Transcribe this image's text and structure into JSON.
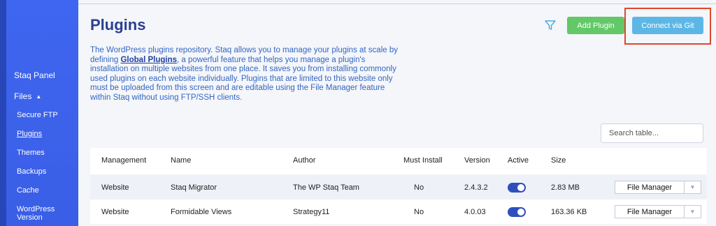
{
  "sidebar": {
    "items": [
      {
        "label": "Staq Panel"
      },
      {
        "label": "Files"
      },
      {
        "label": "Secure FTP"
      },
      {
        "label": "Plugins"
      },
      {
        "label": "Themes"
      },
      {
        "label": "Backups"
      },
      {
        "label": "Cache"
      },
      {
        "label": "WordPress"
      },
      {
        "label": "Version"
      }
    ],
    "files_caret": "▲"
  },
  "header": {
    "title": "Plugins",
    "add_label": "Add Plugin",
    "git_label": "Connect via Git"
  },
  "description": {
    "part1": "The WordPress plugins repository. Staq allows you to manage your plugins at scale by defining ",
    "link": "Global Plugins",
    "part2": ", a powerful feature that helps you manage a plugin's installation on multiple websites from one place. It saves you from installing commonly used plugins on each website individually. Plugins that are limited to this website only must be uploaded from this screen and are editable using the File Manager feature within Staq without using FTP/SSH clients."
  },
  "search": {
    "placeholder": "Search table..."
  },
  "table": {
    "headers": [
      "Management",
      "Name",
      "Author",
      "Must Install",
      "Version",
      "Active",
      "Size"
    ],
    "rows": [
      {
        "management": "Website",
        "name": "Staq Migrator",
        "author": "The WP Staq Team",
        "must_install": "No",
        "version": "2.4.3.2",
        "active": true,
        "size": "2.83 MB",
        "action": "File Manager"
      },
      {
        "management": "Website",
        "name": "Formidable Views",
        "author": "Strategy11",
        "must_install": "No",
        "version": "4.0.03",
        "active": true,
        "size": "163.36 KB",
        "action": "File Manager"
      }
    ]
  },
  "colors": {
    "sidebar": "#3f66f0",
    "title": "#2b3f91",
    "add_button": "#62c868",
    "git_button": "#5db7e6",
    "highlight": "#e2452f",
    "toggle": "#2f4fbf"
  },
  "icons": [
    "filter-icon",
    "caret-up-icon",
    "chevron-down-icon"
  ]
}
